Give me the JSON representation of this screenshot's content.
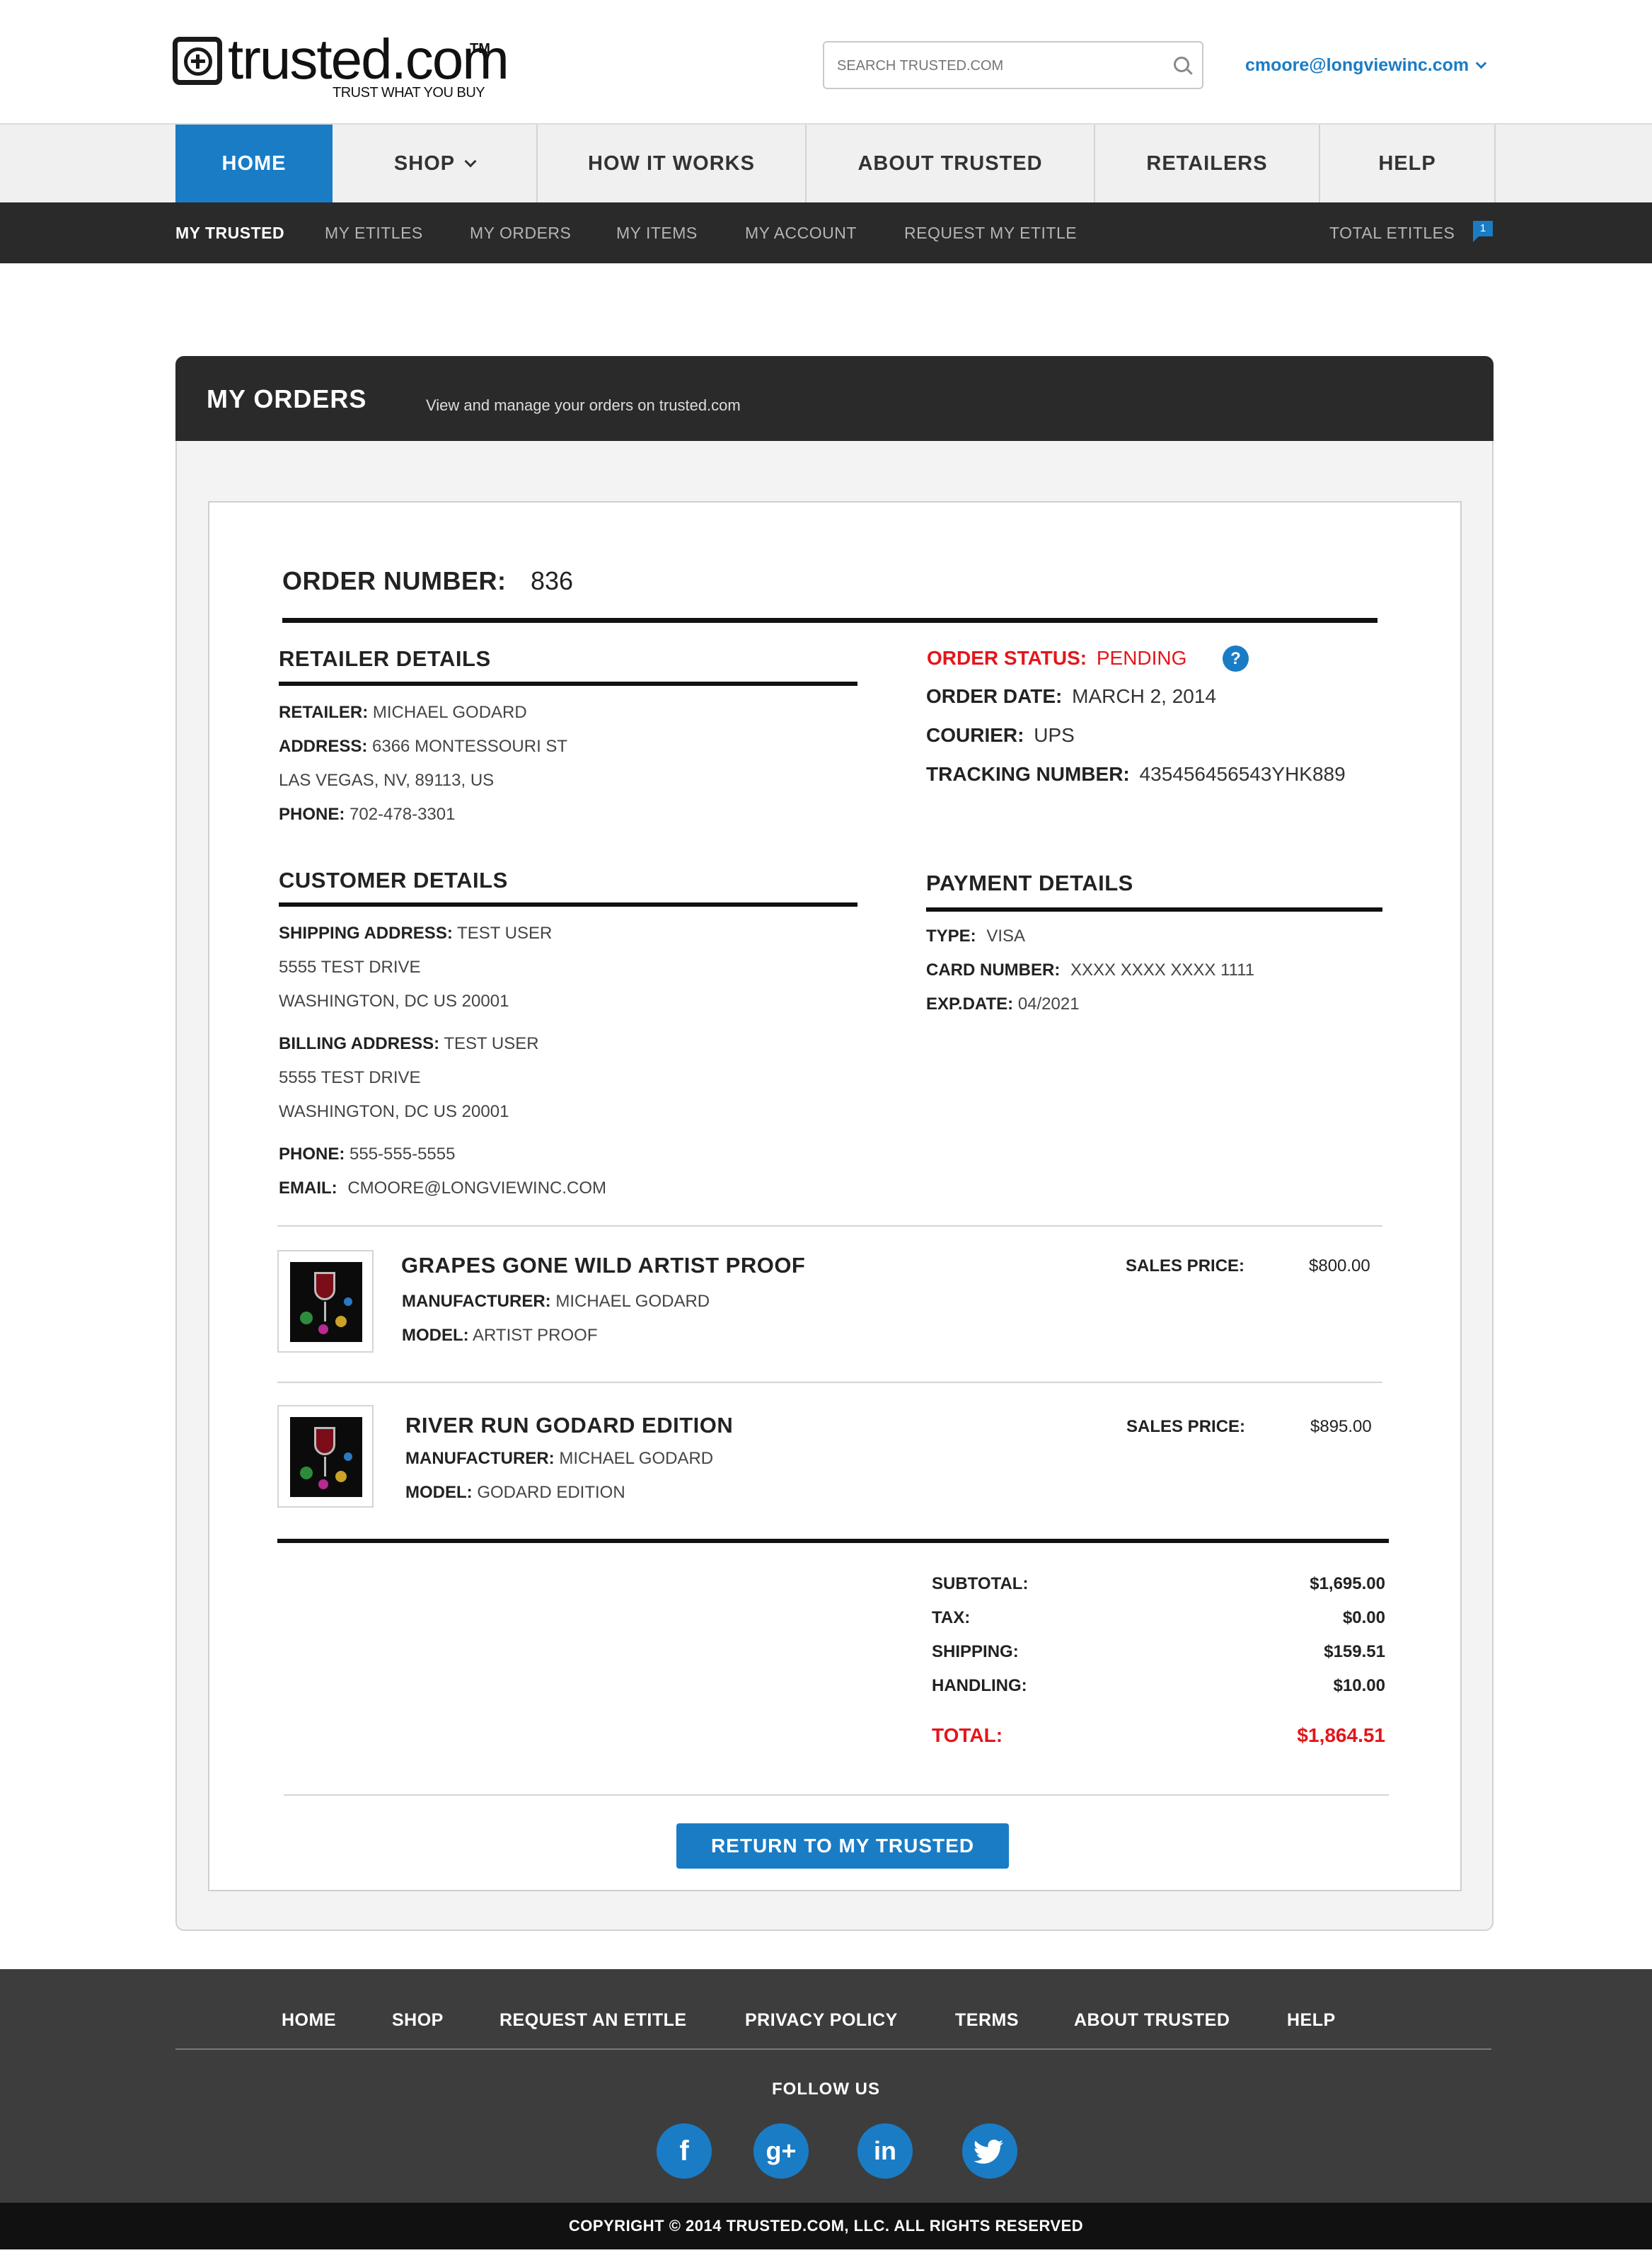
{
  "brand": {
    "name": "trusted.com",
    "tm": "TM",
    "tagline": "TRUST WHAT YOU BUY"
  },
  "search": {
    "placeholder": "SEARCH TRUSTED.COM"
  },
  "user": {
    "email": "cmoore@longviewinc.com"
  },
  "main_nav": {
    "items": [
      {
        "label": "HOME"
      },
      {
        "label": "SHOP"
      },
      {
        "label": "HOW IT WORKS"
      },
      {
        "label": "ABOUT TRUSTED"
      },
      {
        "label": "RETAILERS"
      },
      {
        "label": "HELP"
      }
    ]
  },
  "sub_nav": {
    "items": [
      {
        "label": "MY TRUSTED"
      },
      {
        "label": "MY ETITLES"
      },
      {
        "label": "MY ORDERS"
      },
      {
        "label": "MY ITEMS"
      },
      {
        "label": "MY ACCOUNT"
      },
      {
        "label": "REQUEST MY ETITLE"
      }
    ],
    "total_label": "TOTAL ETITLES",
    "total_count": "1"
  },
  "panel": {
    "title": "MY ORDERS",
    "subtitle": "View and manage your orders on trusted.com"
  },
  "order": {
    "number_label": "ORDER NUMBER:",
    "number": "836",
    "status_label": "ORDER STATUS:",
    "status": "PENDING",
    "status_help_icon": "?",
    "date_label": "ORDER DATE:",
    "date": "MARCH 2, 2014",
    "courier_label": "COURIER:",
    "courier": "UPS",
    "tracking_label": "TRACKING NUMBER:",
    "tracking": "435456456543YHK889"
  },
  "retailer": {
    "heading": "RETAILER DETAILS",
    "retailer_label": "RETAILER:",
    "retailer": "MICHAEL GODARD",
    "address_label": "ADDRESS:",
    "address1": "6366 MONTESSOURI ST",
    "address2": "LAS VEGAS, NV, 89113, US",
    "phone_label": "PHONE:",
    "phone": "702-478-3301"
  },
  "customer": {
    "heading": "CUSTOMER DETAILS",
    "shipping_label": "SHIPPING ADDRESS:",
    "shipping_name": "TEST USER",
    "shipping_line1": "5555 TEST DRIVE",
    "shipping_line2": "WASHINGTON, DC US 20001",
    "billing_label": "BILLING ADDRESS:",
    "billing_name": "TEST USER",
    "billing_line1": "5555 TEST DRIVE",
    "billing_line2": "WASHINGTON, DC US 20001",
    "phone_label": "PHONE:",
    "phone": "555-555-5555",
    "email_label": "EMAIL:",
    "email": "CMOORE@LONGVIEWINC.COM"
  },
  "payment": {
    "heading": "PAYMENT DETAILS",
    "type_label": "TYPE:",
    "type": "VISA",
    "card_label": "CARD NUMBER:",
    "card": "XXXX XXXX XXXX 1111",
    "exp_label": "EXP.DATE:",
    "exp": "04/2021"
  },
  "items": [
    {
      "title": "GRAPES GONE WILD ARTIST PROOF",
      "manufacturer_label": "MANUFACTURER:",
      "manufacturer": "MICHAEL GODARD",
      "model_label": "MODEL:",
      "model": "ARTIST PROOF",
      "price_label": "SALES PRICE:",
      "price": "$800.00"
    },
    {
      "title": "RIVER RUN GODARD EDITION",
      "manufacturer_label": "MANUFACTURER:",
      "manufacturer": "MICHAEL GODARD",
      "model_label": "MODEL:",
      "model": "GODARD EDITION",
      "price_label": "SALES PRICE:",
      "price": "$895.00"
    }
  ],
  "totals": {
    "subtotal_label": "SUBTOTAL:",
    "subtotal": "$1,695.00",
    "tax_label": "TAX:",
    "tax": "$0.00",
    "shipping_label": "SHIPPING:",
    "shipping": "$159.51",
    "handling_label": "HANDLING:",
    "handling": "$10.00",
    "total_label": "TOTAL:",
    "total": "$1,864.51"
  },
  "return_button": "RETURN TO MY TRUSTED",
  "footer": {
    "links": [
      {
        "label": "HOME"
      },
      {
        "label": "SHOP"
      },
      {
        "label": "REQUEST AN ETITLE"
      },
      {
        "label": "PRIVACY POLICY"
      },
      {
        "label": "TERMS"
      },
      {
        "label": "ABOUT TRUSTED"
      },
      {
        "label": "HELP"
      }
    ],
    "follow_label": "FOLLOW US",
    "social": [
      {
        "name": "facebook-icon",
        "glyph": "f"
      },
      {
        "name": "google-plus-icon",
        "glyph": "g+"
      },
      {
        "name": "linkedin-icon",
        "glyph": "in"
      },
      {
        "name": "twitter-icon",
        "glyph": ""
      }
    ],
    "copyright": "COPYRIGHT © 2014 TRUSTED.COM, LLC. ALL RIGHTS RESERVED"
  },
  "colors": {
    "accent": "#1a7cc5",
    "alert": "#e3161b",
    "dark_bar": "#2a2a2a",
    "footer_bg": "#3d3d3d"
  }
}
